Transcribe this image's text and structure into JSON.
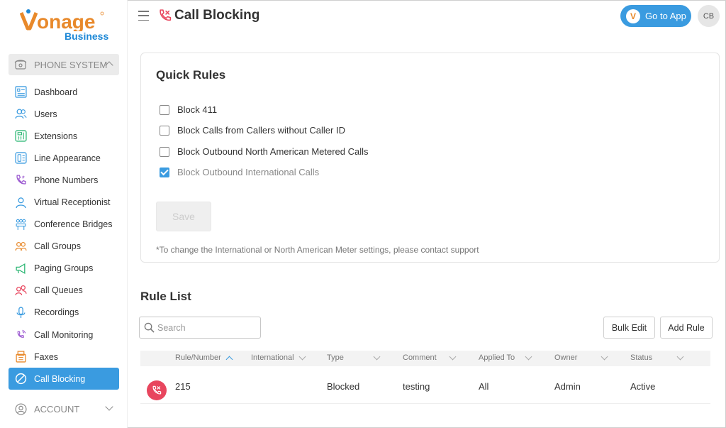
{
  "brand": {
    "name": "Vonage",
    "sub": "Business"
  },
  "sidebar": {
    "section": "PHONE SYSTEM",
    "items": [
      {
        "label": "Dashboard",
        "icon": "dashboard-icon"
      },
      {
        "label": "Users",
        "icon": "users-icon"
      },
      {
        "label": "Extensions",
        "icon": "extensions-icon"
      },
      {
        "label": "Line Appearance",
        "icon": "line-appearance-icon"
      },
      {
        "label": "Phone Numbers",
        "icon": "phone-numbers-icon"
      },
      {
        "label": "Virtual Receptionist",
        "icon": "receptionist-icon"
      },
      {
        "label": "Conference Bridges",
        "icon": "conference-icon"
      },
      {
        "label": "Call Groups",
        "icon": "call-groups-icon"
      },
      {
        "label": "Paging Groups",
        "icon": "megaphone-icon"
      },
      {
        "label": "Call Queues",
        "icon": "call-queues-icon"
      },
      {
        "label": "Recordings",
        "icon": "microphone-icon"
      },
      {
        "label": "Call Monitoring",
        "icon": "monitoring-icon"
      },
      {
        "label": "Faxes",
        "icon": "fax-icon"
      },
      {
        "label": "Call Blocking",
        "icon": "block-icon"
      }
    ],
    "account": "ACCOUNT"
  },
  "header": {
    "title": "Call Blocking",
    "goto_label": "Go to App",
    "avatar_initials": "CB"
  },
  "quick_rules": {
    "title": "Quick Rules",
    "rules": [
      {
        "label": "Block 411",
        "checked": false
      },
      {
        "label": "Block Calls from Callers without Caller ID",
        "checked": false
      },
      {
        "label": "Block Outbound North American Metered Calls",
        "checked": false
      },
      {
        "label": "Block Outbound International Calls",
        "checked": true
      }
    ],
    "save_label": "Save",
    "note": "*To change the International or North American Meter settings, please contact support"
  },
  "rule_list": {
    "title": "Rule List",
    "search_placeholder": "Search",
    "bulk_edit_label": "Bulk Edit",
    "add_rule_label": "Add Rule",
    "columns": [
      "Rule/Number",
      "International",
      "Type",
      "Comment",
      "Applied To",
      "Owner",
      "Status"
    ],
    "rows": [
      {
        "number": "215",
        "international": "",
        "type": "Blocked",
        "comment": "testing",
        "applied_to": "All",
        "owner": "Admin",
        "status": "Active"
      }
    ]
  },
  "colors": {
    "accent": "#3a9be0",
    "brand_orange": "#e8892b",
    "block_red": "#e8465e"
  }
}
